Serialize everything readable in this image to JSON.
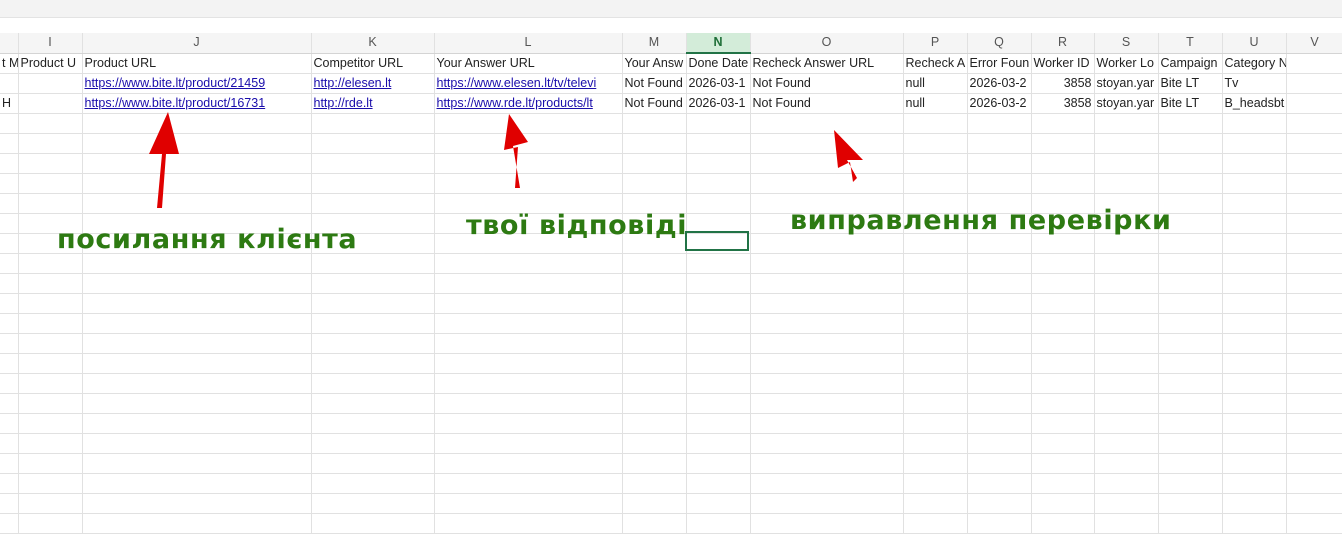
{
  "columns": [
    {
      "letter": ""
    },
    {
      "letter": "I"
    },
    {
      "letter": "J"
    },
    {
      "letter": "K"
    },
    {
      "letter": "L"
    },
    {
      "letter": "M"
    },
    {
      "letter": "N"
    },
    {
      "letter": "O"
    },
    {
      "letter": "P"
    },
    {
      "letter": "Q"
    },
    {
      "letter": "R"
    },
    {
      "letter": "S"
    },
    {
      "letter": "T"
    },
    {
      "letter": "U"
    },
    {
      "letter": "V"
    }
  ],
  "header_row": [
    "t M",
    "Product U",
    "Product URL",
    "Competitor URL",
    "Your Answer URL",
    "Your Answ",
    "Done Date",
    "Recheck Answer URL",
    "Recheck A",
    "Error Foun",
    "Worker ID",
    "Worker Lo",
    "Campaign",
    "Category Name",
    ""
  ],
  "rows": [
    [
      "",
      "",
      "https://www.bite.lt/product/21459",
      "http://elesen.lt",
      "https://www.elesen.lt/tv/televi",
      "Not Found",
      "2026-03-1",
      "Not Found",
      "null",
      "2026-03-2",
      "3858",
      "stoyan.yar",
      "Bite LT",
      "Tv",
      ""
    ],
    [
      "H",
      "",
      "https://www.bite.lt/product/16731",
      "http://rde.lt",
      "https://www.rde.lt/products/lt",
      "Not Found",
      "2026-03-1",
      "Not Found",
      "null",
      "2026-03-2",
      "3858",
      "stoyan.yar",
      "Bite LT",
      "B_headsbt",
      ""
    ]
  ],
  "empty_row_count": 21,
  "active_column": "N",
  "annotations": {
    "client_link": "посилання клієнта",
    "your_answers": "твої відповіді",
    "recheck_fix": "виправлення перевірки"
  },
  "colors": {
    "annotation_text": "#2d7a12",
    "arrow": "#e00000",
    "link": "#1a0dab",
    "selection": "#217346"
  }
}
